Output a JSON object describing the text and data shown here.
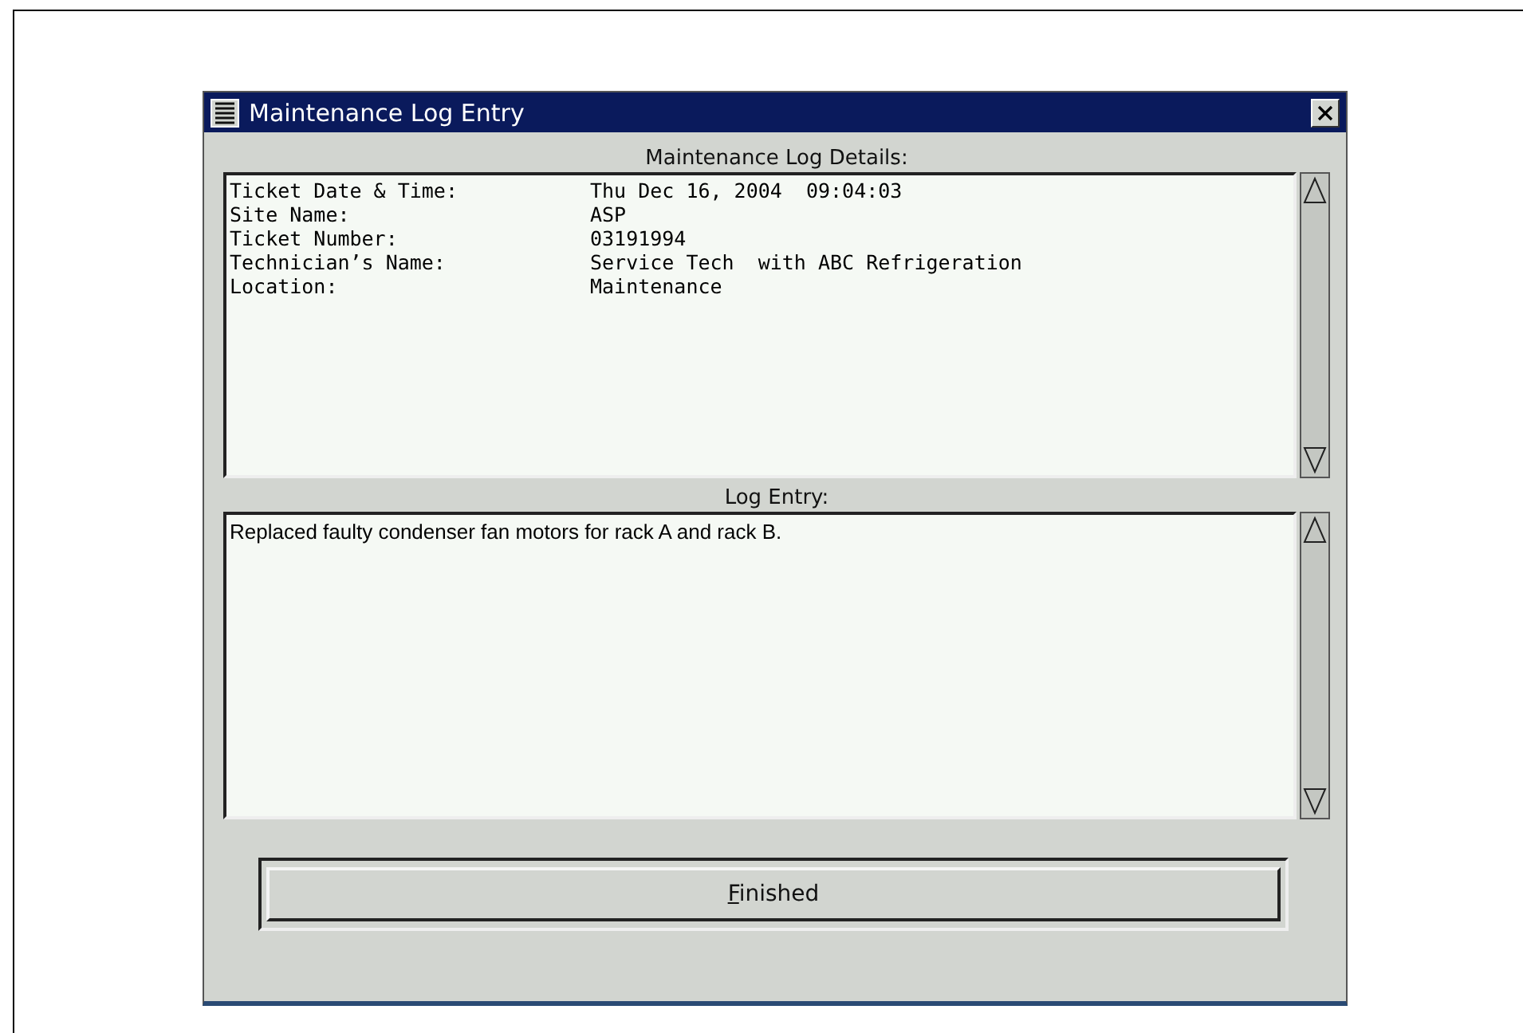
{
  "window": {
    "title": "Maintenance Log Entry"
  },
  "details": {
    "heading": "Maintenance Log Details:",
    "rows": [
      {
        "label": "Ticket Date & Time:",
        "value": "Thu Dec 16, 2004  09:04:03"
      },
      {
        "label": "Site Name:",
        "value": "ASP"
      },
      {
        "label": "Ticket Number:",
        "value": "03191994"
      },
      {
        "label": "Technician’s Name:",
        "value": "Service Tech  with ABC Refrigeration"
      },
      {
        "label": "Location:",
        "value": "Maintenance"
      }
    ]
  },
  "log_entry": {
    "heading": "Log Entry:",
    "value": "Replaced faulty condenser fan motors for rack A and rack B."
  },
  "buttons": [
    {
      "label": "Finished",
      "mnemonic_underlined": true
    }
  ]
}
